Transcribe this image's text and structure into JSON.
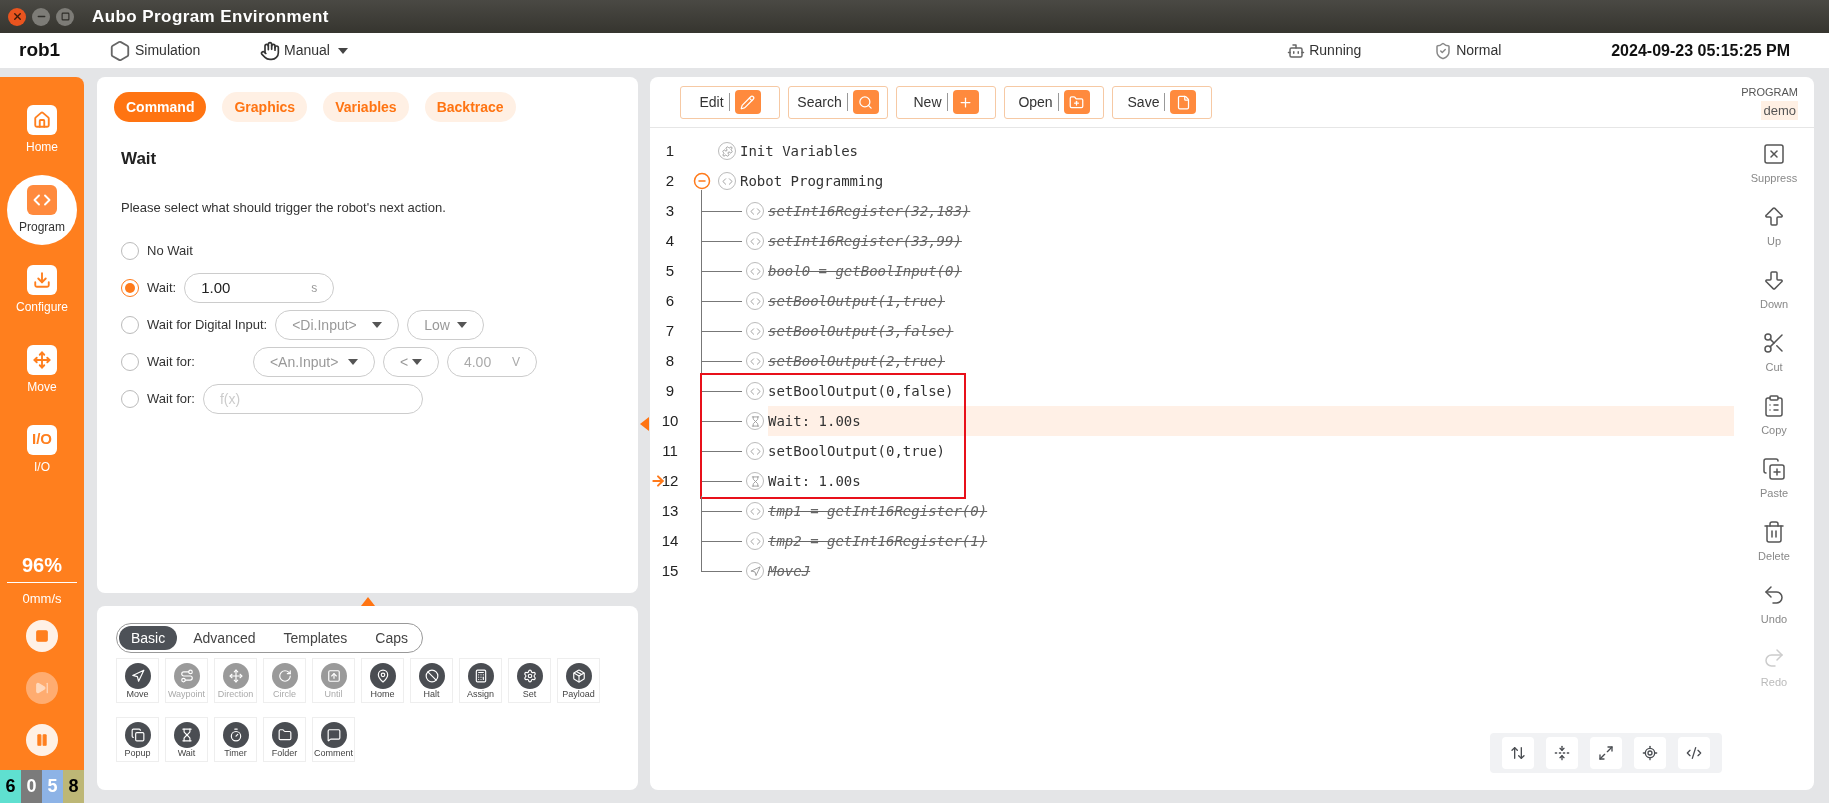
{
  "window": {
    "title": "Aubo Program Environment"
  },
  "top_bar": {
    "robot": "rob1",
    "mode": "Simulation",
    "control": "Manual",
    "run_state": "Running",
    "safety": "Normal",
    "datetime": "2024-09-23 05:15:25 PM"
  },
  "sidebar": {
    "items": [
      {
        "label": "Home",
        "selected": false
      },
      {
        "label": "Program",
        "selected": true
      },
      {
        "label": "Configure",
        "selected": false
      },
      {
        "label": "Move",
        "selected": false
      },
      {
        "label": "I/O",
        "glyph": "I/O",
        "selected": false
      }
    ],
    "speed": "96%",
    "velocity": "0mm/s",
    "controls": [
      {
        "kind": "stop",
        "disabled": false
      },
      {
        "kind": "step",
        "disabled": true
      },
      {
        "kind": "pause",
        "disabled": false
      }
    ],
    "counters": [
      {
        "text": "6",
        "color": "#5fe0d0"
      },
      {
        "text": "0",
        "color": "#7b7b7b"
      },
      {
        "text": "5",
        "color": "#8db3e6"
      },
      {
        "text": "8",
        "color": "#bdb776"
      }
    ]
  },
  "command_panel": {
    "tabs": [
      {
        "label": "Command",
        "selected": true
      },
      {
        "label": "Graphics",
        "selected": false
      },
      {
        "label": "Variables",
        "selected": false
      },
      {
        "label": "Backtrace",
        "selected": false
      }
    ],
    "title": "Wait",
    "description": "Please select what should trigger the robot's next action.",
    "options": [
      {
        "kind": "plain",
        "label": "No Wait",
        "selected": false
      },
      {
        "kind": "duration",
        "label": "Wait:",
        "selected": true,
        "value": "1.00",
        "unit": "s"
      },
      {
        "kind": "digital",
        "label": "Wait for Digital Input:",
        "selected": false,
        "input": "<Di.Input>",
        "state": "Low"
      },
      {
        "kind": "analog",
        "label": "Wait for:",
        "selected": false,
        "input": "<An.Input>",
        "operator": "<",
        "value": "4.00",
        "unit": "V"
      },
      {
        "kind": "expression",
        "label": "Wait for:",
        "selected": false,
        "placeholder": "f(x)"
      }
    ]
  },
  "palette": {
    "tabs": [
      {
        "label": "Basic",
        "selected": true
      },
      {
        "label": "Advanced",
        "selected": false
      },
      {
        "label": "Templates",
        "selected": false
      },
      {
        "label": "Caps",
        "selected": false
      }
    ],
    "commands": [
      {
        "label": "Move",
        "disabled": false
      },
      {
        "label": "Waypoint",
        "disabled": true
      },
      {
        "label": "Direction",
        "disabled": true
      },
      {
        "label": "Circle",
        "disabled": true
      },
      {
        "label": "Until",
        "disabled": true
      },
      {
        "label": "Home",
        "disabled": false
      },
      {
        "label": "Halt",
        "disabled": false
      },
      {
        "label": "Assign",
        "disabled": false
      },
      {
        "label": "Set",
        "disabled": false
      },
      {
        "label": "Payload",
        "disabled": false
      },
      {
        "label": "Popup",
        "disabled": false
      },
      {
        "label": "Wait",
        "disabled": false
      },
      {
        "label": "Timer",
        "disabled": false
      },
      {
        "label": "Folder",
        "disabled": false
      },
      {
        "label": "Comment",
        "disabled": false
      }
    ]
  },
  "program_panel": {
    "toolbar": [
      {
        "label": "Edit"
      },
      {
        "label": "Search"
      },
      {
        "label": "New"
      },
      {
        "label": "Open"
      },
      {
        "label": "Save"
      }
    ],
    "program_label": "PROGRAM",
    "program_name": "demo",
    "lines": [
      {
        "number": "1",
        "kind": "init",
        "text": "Init Variables",
        "suppressed": false,
        "selected": false,
        "current": false,
        "marked": false
      },
      {
        "number": "2",
        "kind": "folder",
        "text": "Robot Programming",
        "suppressed": false,
        "selected": false,
        "current": false,
        "marked": false,
        "expanded": true,
        "children": [
          {
            "number": "3",
            "kind": "script",
            "text": "setInt16Register(32,183)",
            "suppressed": true,
            "selected": false,
            "current": false,
            "marked": false
          },
          {
            "number": "4",
            "kind": "script",
            "text": "setInt16Register(33,99)",
            "suppressed": true,
            "selected": false,
            "current": false,
            "marked": false
          },
          {
            "number": "5",
            "kind": "script",
            "text": "bool0 = getBoolInput(0)",
            "suppressed": true,
            "selected": false,
            "current": false,
            "marked": false
          },
          {
            "number": "6",
            "kind": "script",
            "text": "setBoolOutput(1,true)",
            "suppressed": true,
            "selected": false,
            "current": false,
            "marked": false
          },
          {
            "number": "7",
            "kind": "script",
            "text": "setBoolOutput(3,false)",
            "suppressed": true,
            "selected": false,
            "current": false,
            "marked": false
          },
          {
            "number": "8",
            "kind": "script",
            "text": "setBoolOutput(2,true)",
            "suppressed": true,
            "selected": false,
            "current": false,
            "marked": false
          },
          {
            "number": "9",
            "kind": "script",
            "text": "setBoolOutput(0,false)",
            "suppressed": false,
            "selected": false,
            "current": false,
            "marked": true
          },
          {
            "number": "10",
            "kind": "wait",
            "text": "Wait: 1.00s",
            "suppressed": false,
            "selected": true,
            "current": false,
            "marked": true
          },
          {
            "number": "11",
            "kind": "script",
            "text": "setBoolOutput(0,true)",
            "suppressed": false,
            "selected": false,
            "current": false,
            "marked": true
          },
          {
            "number": "12",
            "kind": "wait",
            "text": "Wait: 1.00s",
            "suppressed": false,
            "selected": false,
            "current": true,
            "marked": true
          },
          {
            "number": "13",
            "kind": "script",
            "text": "tmp1 = getInt16Register(0)",
            "suppressed": true,
            "selected": false,
            "current": false,
            "marked": false
          },
          {
            "number": "14",
            "kind": "script",
            "text": "tmp2 = getInt16Register(1)",
            "suppressed": true,
            "selected": false,
            "current": false,
            "marked": false
          },
          {
            "number": "15",
            "kind": "move",
            "text": "MoveJ",
            "suppressed": true,
            "selected": false,
            "current": false,
            "marked": false
          }
        ]
      }
    ],
    "actions": [
      {
        "label": "Suppress",
        "disabled": false
      },
      {
        "label": "Up",
        "disabled": false
      },
      {
        "label": "Down",
        "disabled": false
      },
      {
        "label": "Cut",
        "disabled": false
      },
      {
        "label": "Copy",
        "disabled": false
      },
      {
        "label": "Paste",
        "disabled": false
      },
      {
        "label": "Delete",
        "disabled": false
      },
      {
        "label": "Undo",
        "disabled": false
      },
      {
        "label": "Redo",
        "disabled": true
      }
    ]
  }
}
